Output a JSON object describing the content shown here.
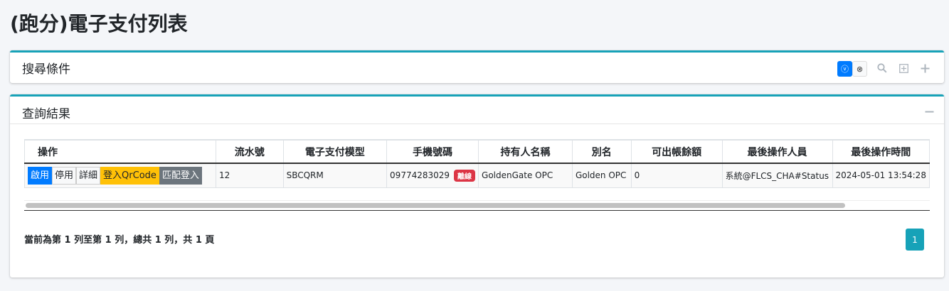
{
  "page": {
    "title": "(跑分)電子支付列表"
  },
  "search_card": {
    "title": "搜尋條件",
    "tools": {
      "toggle_a": "ⓥ",
      "toggle_b": "⊗",
      "search": "⌕",
      "expand": "⊞",
      "add": "+"
    }
  },
  "result_card": {
    "title": "查詢結果",
    "collapse": "−",
    "table": {
      "headers": [
        "操作",
        "流水號",
        "電子支付模型",
        "手機號碼",
        "持有人名稱",
        "別名",
        "可出帳餘額",
        "最後操作人員",
        "最後操作時間"
      ],
      "rows": [
        {
          "ops": {
            "enable": "啟用",
            "disable": "停用",
            "detail": "詳細",
            "qrcode": "登入QrCode",
            "match": "匹配登入"
          },
          "serial": "12",
          "model": "SBCQRM",
          "phone": "09774283029",
          "status_badge": "離線",
          "holder": "GoldenGate OPC",
          "alias": "Golden OPC",
          "balance": "0",
          "last_operator": "系統@FLCS_CHA#Status",
          "last_time": "2024-05-01 13:54:28"
        }
      ]
    },
    "pager": {
      "info": "當前為第 1 列至第 1 列，總共 1 列，共 1 頁",
      "current_page": "1"
    }
  },
  "colors": {
    "accent": "#17a2b8",
    "primary": "#007bff",
    "warning": "#ffc107",
    "secondary": "#6c757d",
    "danger": "#dc3545"
  }
}
